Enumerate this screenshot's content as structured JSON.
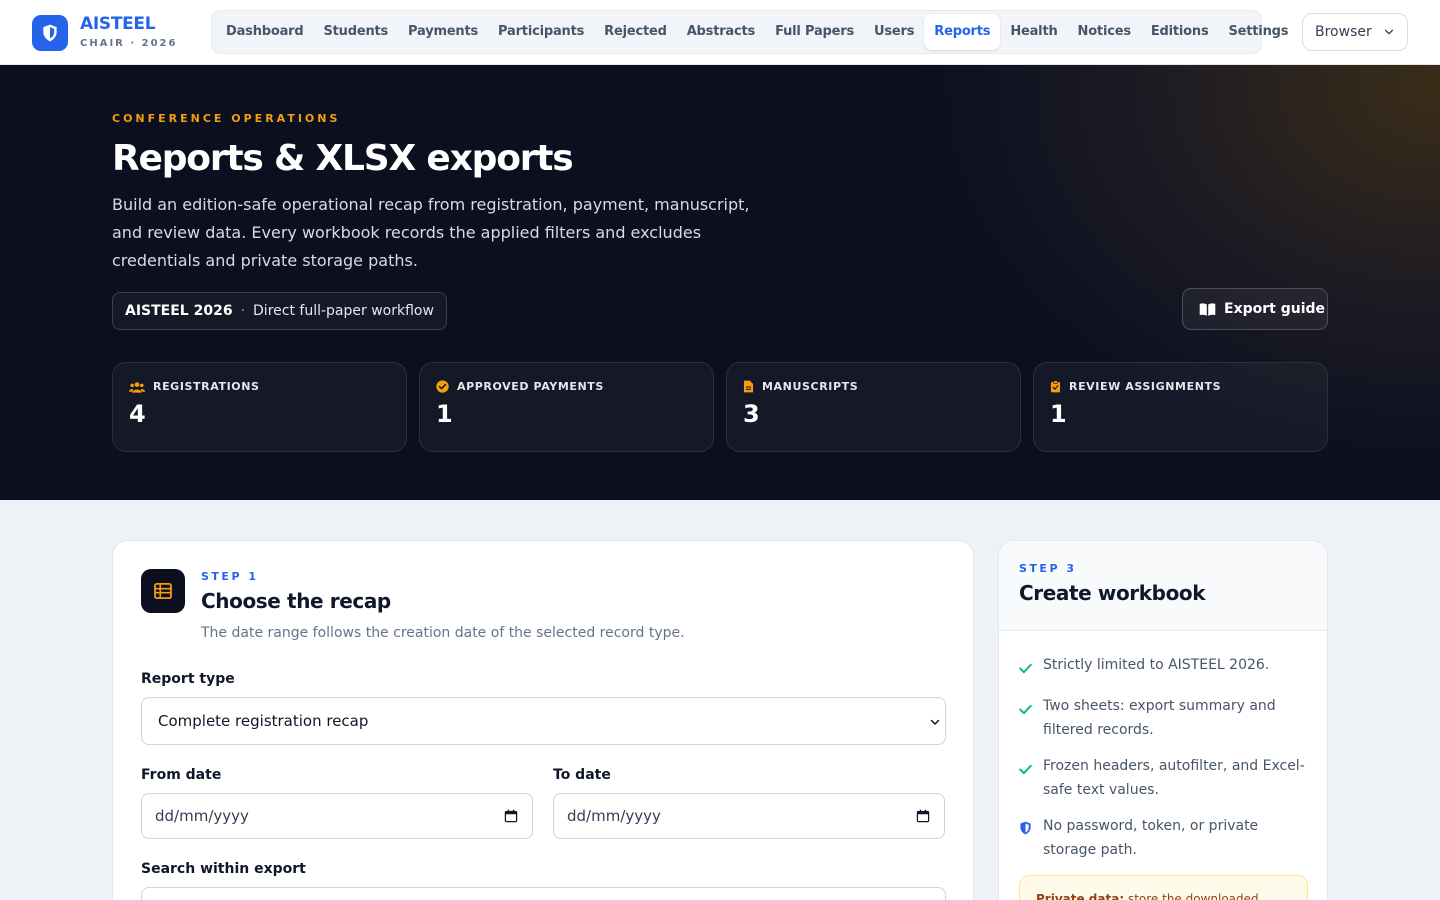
{
  "brand": {
    "name": "AISTEEL",
    "subtitle": "CHAIR · 2026"
  },
  "nav": {
    "items": [
      {
        "label": "Dashboard",
        "active": false
      },
      {
        "label": "Students",
        "active": false
      },
      {
        "label": "Payments",
        "active": false
      },
      {
        "label": "Participants",
        "active": false
      },
      {
        "label": "Rejected",
        "active": false
      },
      {
        "label": "Abstracts",
        "active": false
      },
      {
        "label": "Full Papers",
        "active": false
      },
      {
        "label": "Users",
        "active": false
      },
      {
        "label": "Reports",
        "active": true
      },
      {
        "label": "Health",
        "active": false
      },
      {
        "label": "Notices",
        "active": false
      },
      {
        "label": "Editions",
        "active": false
      },
      {
        "label": "Settings",
        "active": false
      }
    ],
    "browser_label": "Browser"
  },
  "hero": {
    "eyebrow": "CONFERENCE OPERATIONS",
    "title": "Reports & XLSX exports",
    "description": "Build an edition-safe operational recap from registration, payment, manuscript, and review data. Every workbook records the applied filters and excludes credentials and private storage paths.",
    "edition_name": "AISTEEL 2026",
    "edition_separator": "·",
    "edition_workflow": "Direct full-paper workflow",
    "guide_button": "Export guide"
  },
  "stats": [
    {
      "label": "REGISTRATIONS",
      "value": "4",
      "icon": "users-icon"
    },
    {
      "label": "APPROVED PAYMENTS",
      "value": "1",
      "icon": "check-circle-icon"
    },
    {
      "label": "MANUSCRIPTS",
      "value": "3",
      "icon": "document-icon"
    },
    {
      "label": "REVIEW ASSIGNMENTS",
      "value": "1",
      "icon": "clipboard-icon"
    }
  ],
  "step1": {
    "step": "STEP 1",
    "title": "Choose the recap",
    "subtitle": "The date range follows the creation date of the selected record type.",
    "report_type_label": "Report type",
    "report_type_value": "Complete registration recap",
    "from_label": "From date",
    "from_placeholder": "dd/mm/yyyy",
    "to_label": "To date",
    "to_placeholder": "dd/mm/yyyy",
    "search_label": "Search within export"
  },
  "step3": {
    "step": "STEP 3",
    "title": "Create workbook",
    "checks": [
      "Strictly limited to AISTEEL 2026.",
      "Two sheets: export summary and filtered records.",
      "Frozen headers, autofilter, and Excel-safe text values."
    ],
    "shield_note": "No password, token, or private storage path.",
    "notice_bold": "Private data:",
    "notice_text": "store the downloaded"
  },
  "colors": {
    "accent": "#2563eb",
    "amber": "#f59e0b",
    "hero_bg": "#0b0f1f",
    "check": "#10b981"
  }
}
